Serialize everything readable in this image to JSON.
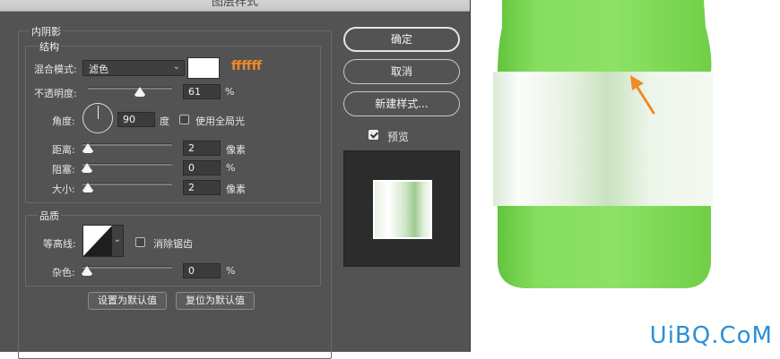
{
  "dialog": {
    "title": "图层样式"
  },
  "inner_shadow": {
    "section_title": "内阴影",
    "structure": {
      "legend": "结构",
      "blend_mode_label": "混合模式:",
      "blend_mode_value": "滤色",
      "color_hex_text": "ffffff",
      "color_swatch": "#ffffff",
      "opacity_label": "不透明度:",
      "opacity_value": "61",
      "opacity_unit": "%",
      "angle_label": "角度:",
      "angle_value": "90",
      "angle_unit": "度",
      "global_light_label": "使用全局光",
      "global_light_checked": false,
      "distance_label": "距离:",
      "distance_value": "2",
      "distance_unit": "像素",
      "choke_label": "阻塞:",
      "choke_value": "0",
      "choke_unit": "%",
      "size_label": "大小:",
      "size_value": "2",
      "size_unit": "像素"
    },
    "quality": {
      "legend": "品质",
      "contour_label": "等高线:",
      "anti_alias_label": "消除锯齿",
      "anti_alias_checked": false,
      "noise_label": "杂色:",
      "noise_value": "0",
      "noise_unit": "%"
    },
    "make_default_label": "设置为默认值",
    "reset_default_label": "复位为默认值"
  },
  "side_panel": {
    "ok_label": "确定",
    "cancel_label": "取消",
    "new_style_label": "新建样式...",
    "preview_label": "预览",
    "preview_checked": true
  },
  "canvas": {
    "watermark": "UiBQ.CoM",
    "bottle_color": "#7ed957",
    "arrow_color": "#f0892a"
  },
  "accent_orange": "#f0892a"
}
